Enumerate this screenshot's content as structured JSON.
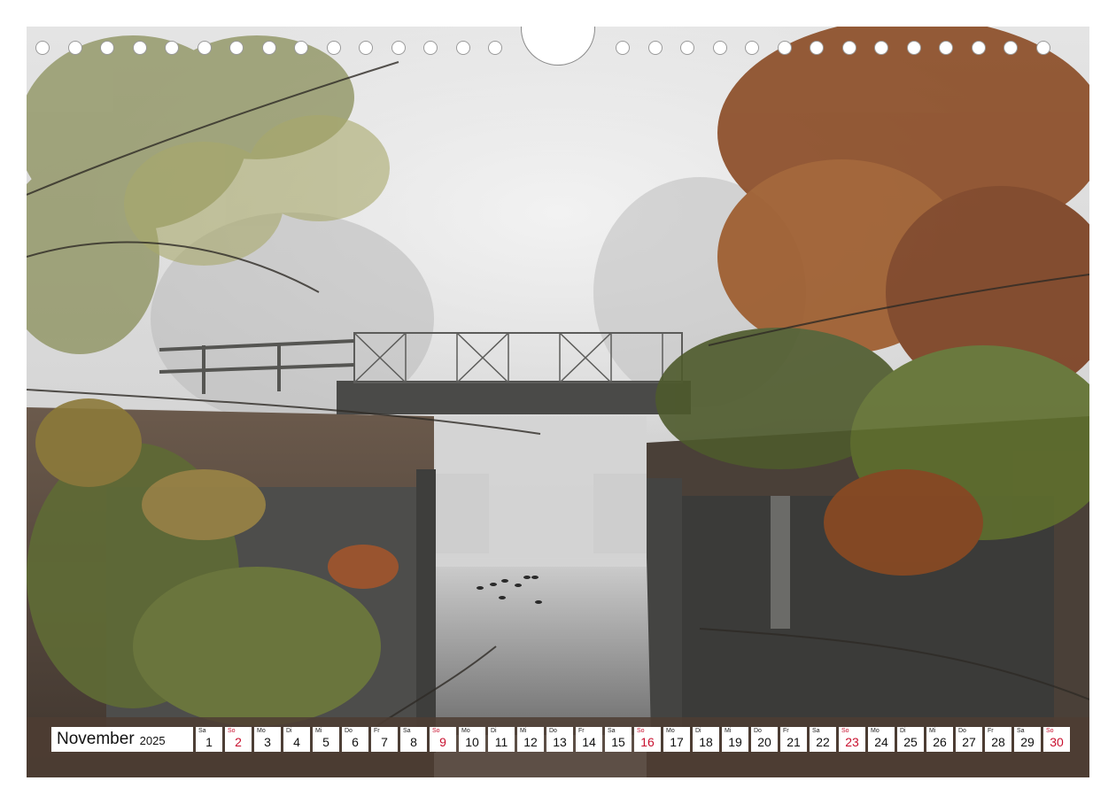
{
  "calendar": {
    "month": "November",
    "year": "2025",
    "accent_sunday_color": "#c8102e",
    "days": [
      {
        "wd": "Sa",
        "n": "1",
        "sunday": false
      },
      {
        "wd": "So",
        "n": "2",
        "sunday": true
      },
      {
        "wd": "Mo",
        "n": "3",
        "sunday": false
      },
      {
        "wd": "Di",
        "n": "4",
        "sunday": false
      },
      {
        "wd": "Mi",
        "n": "5",
        "sunday": false
      },
      {
        "wd": "Do",
        "n": "6",
        "sunday": false
      },
      {
        "wd": "Fr",
        "n": "7",
        "sunday": false
      },
      {
        "wd": "Sa",
        "n": "8",
        "sunday": false
      },
      {
        "wd": "So",
        "n": "9",
        "sunday": true
      },
      {
        "wd": "Mo",
        "n": "10",
        "sunday": false
      },
      {
        "wd": "Di",
        "n": "11",
        "sunday": false
      },
      {
        "wd": "Mi",
        "n": "12",
        "sunday": false
      },
      {
        "wd": "Do",
        "n": "13",
        "sunday": false
      },
      {
        "wd": "Fr",
        "n": "14",
        "sunday": false
      },
      {
        "wd": "Sa",
        "n": "15",
        "sunday": false
      },
      {
        "wd": "So",
        "n": "16",
        "sunday": true
      },
      {
        "wd": "Mo",
        "n": "17",
        "sunday": false
      },
      {
        "wd": "Di",
        "n": "18",
        "sunday": false
      },
      {
        "wd": "Mi",
        "n": "19",
        "sunday": false
      },
      {
        "wd": "Do",
        "n": "20",
        "sunday": false
      },
      {
        "wd": "Fr",
        "n": "21",
        "sunday": false
      },
      {
        "wd": "Sa",
        "n": "22",
        "sunday": false
      },
      {
        "wd": "So",
        "n": "23",
        "sunday": true
      },
      {
        "wd": "Mo",
        "n": "24",
        "sunday": false
      },
      {
        "wd": "Di",
        "n": "25",
        "sunday": false
      },
      {
        "wd": "Mi",
        "n": "26",
        "sunday": false
      },
      {
        "wd": "Do",
        "n": "27",
        "sunday": false
      },
      {
        "wd": "Fr",
        "n": "28",
        "sunday": false
      },
      {
        "wd": "Sa",
        "n": "29",
        "sunday": false
      },
      {
        "wd": "So",
        "n": "30",
        "sunday": true
      }
    ]
  }
}
